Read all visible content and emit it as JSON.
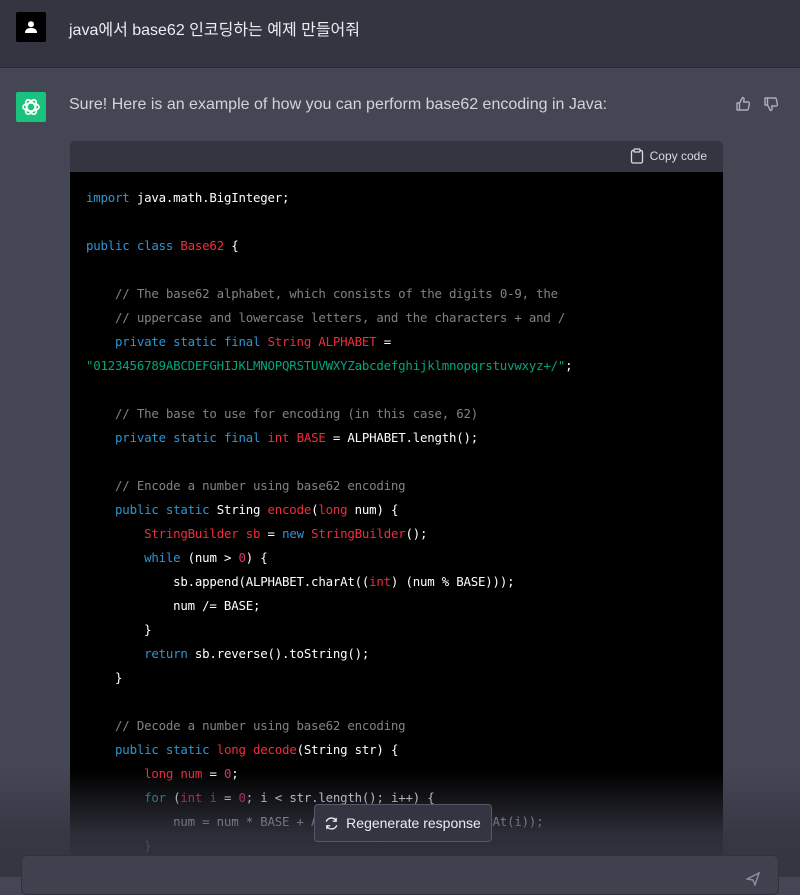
{
  "user_message": "java에서 base62 인코딩하는 예제 만들어줘",
  "assistant_intro": "Sure! Here is an example of how you can perform base62 encoding in Java:",
  "copy_label": "Copy code",
  "regenerate_label": "Regenerate response",
  "code_lines": [
    [
      [
        "kw",
        "import"
      ],
      [
        "t",
        " java.math.BigInteger;"
      ]
    ],
    [],
    [
      [
        "kw",
        "public class"
      ],
      [
        "t",
        " "
      ],
      [
        "cls",
        "Base62"
      ],
      [
        "t",
        " {"
      ]
    ],
    [],
    [
      [
        "t",
        "    "
      ],
      [
        "cm",
        "// The base62 alphabet, which consists of the digits 0-9, the"
      ]
    ],
    [
      [
        "t",
        "    "
      ],
      [
        "cm",
        "// uppercase and lowercase letters, and the characters + and /"
      ]
    ],
    [
      [
        "t",
        "    "
      ],
      [
        "kw",
        "private static final"
      ],
      [
        "t",
        " "
      ],
      [
        "cls",
        "String"
      ],
      [
        "t",
        " "
      ],
      [
        "cls",
        "ALPHABET"
      ],
      [
        "t",
        " ="
      ]
    ],
    [
      [
        "str",
        "\"0123456789ABCDEFGHIJKLMNOPQRSTUVWXYZabcdefghijklmnopqrstuvwxyz+/\""
      ],
      [
        "t",
        ";"
      ]
    ],
    [],
    [
      [
        "t",
        "    "
      ],
      [
        "cm",
        "// The base to use for encoding (in this case, 62)"
      ]
    ],
    [
      [
        "t",
        "    "
      ],
      [
        "kw",
        "private static final"
      ],
      [
        "t",
        " "
      ],
      [
        "cls",
        "int"
      ],
      [
        "t",
        " "
      ],
      [
        "cls",
        "BASE"
      ],
      [
        "t",
        " = ALPHABET.length();"
      ]
    ],
    [],
    [
      [
        "t",
        "    "
      ],
      [
        "cm",
        "// Encode a number using base62 encoding"
      ]
    ],
    [
      [
        "t",
        "    "
      ],
      [
        "kw",
        "public static"
      ],
      [
        "t",
        " String "
      ],
      [
        "fn",
        "encode"
      ],
      [
        "t",
        "("
      ],
      [
        "cls",
        "long"
      ],
      [
        "t",
        " num) {"
      ]
    ],
    [
      [
        "t",
        "        "
      ],
      [
        "cls",
        "StringBuilder"
      ],
      [
        "t",
        " "
      ],
      [
        "cls",
        "sb"
      ],
      [
        "t",
        " = "
      ],
      [
        "kw",
        "new"
      ],
      [
        "t",
        " "
      ],
      [
        "cls",
        "StringBuilder"
      ],
      [
        "t",
        "();"
      ]
    ],
    [
      [
        "t",
        "        "
      ],
      [
        "kw",
        "while"
      ],
      [
        "t",
        " (num > "
      ],
      [
        "num",
        "0"
      ],
      [
        "t",
        ") {"
      ]
    ],
    [
      [
        "t",
        "            sb.append(ALPHABET.charAt(("
      ],
      [
        "cls",
        "int"
      ],
      [
        "t",
        ") (num % BASE)));"
      ]
    ],
    [
      [
        "t",
        "            num /= BASE;"
      ]
    ],
    [
      [
        "t",
        "        }"
      ]
    ],
    [
      [
        "t",
        "        "
      ],
      [
        "kw",
        "return"
      ],
      [
        "t",
        " sb.reverse().toString();"
      ]
    ],
    [
      [
        "t",
        "    }"
      ]
    ],
    [],
    [
      [
        "t",
        "    "
      ],
      [
        "cm",
        "// Decode a number using base62 encoding"
      ]
    ],
    [
      [
        "t",
        "    "
      ],
      [
        "kw",
        "public static"
      ],
      [
        "t",
        " "
      ],
      [
        "cls",
        "long"
      ],
      [
        "t",
        " "
      ],
      [
        "fn",
        "decode"
      ],
      [
        "t",
        "(String str) {"
      ]
    ],
    [
      [
        "t",
        "        "
      ],
      [
        "cls",
        "long"
      ],
      [
        "t",
        " "
      ],
      [
        "cls",
        "num"
      ],
      [
        "t",
        " = "
      ],
      [
        "num",
        "0"
      ],
      [
        "t",
        ";"
      ]
    ],
    [
      [
        "t",
        "        "
      ],
      [
        "kw",
        "for"
      ],
      [
        "t",
        " ("
      ],
      [
        "cls",
        "int"
      ],
      [
        "t",
        " "
      ],
      [
        "cls",
        "i"
      ],
      [
        "t",
        " = "
      ],
      [
        "num",
        "0"
      ],
      [
        "t",
        "; i < str.length(); i++) {"
      ]
    ],
    [
      [
        "t",
        "            num = num * BASE + ALPHABET.indexOf(str.charAt(i));"
      ]
    ],
    [
      [
        "t",
        "        }"
      ]
    ]
  ]
}
